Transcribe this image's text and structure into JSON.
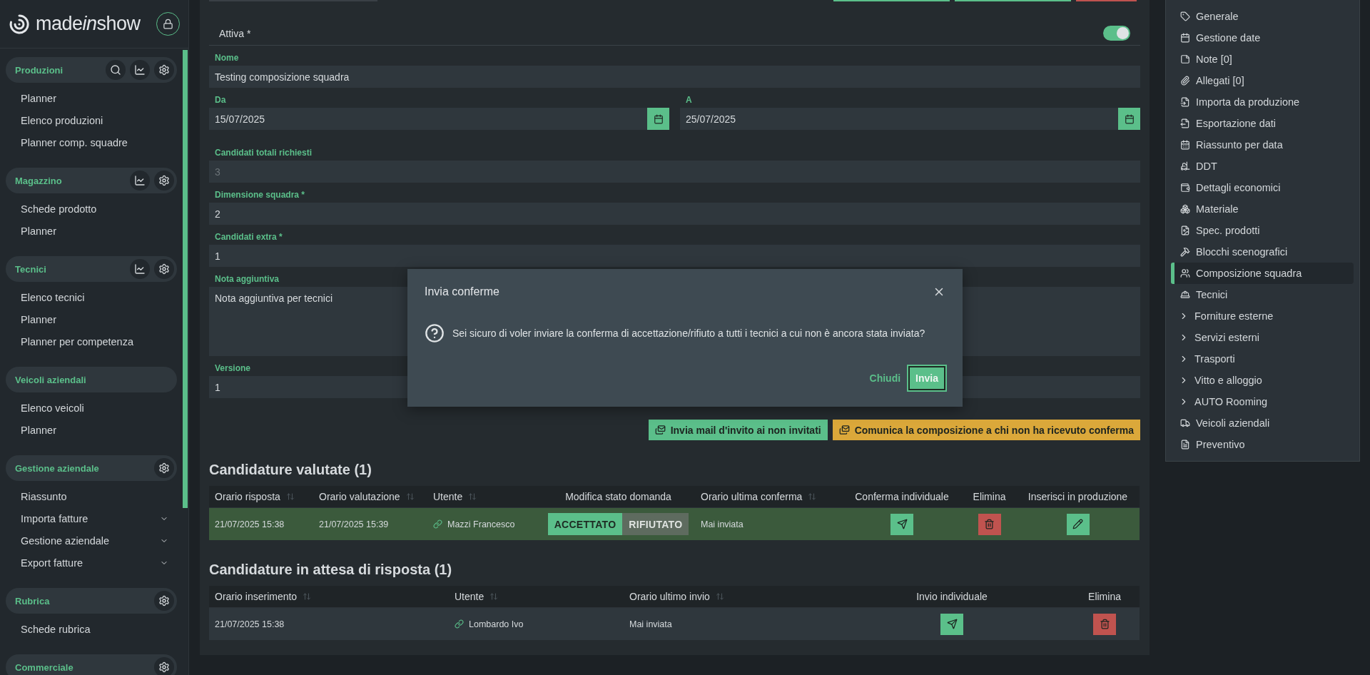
{
  "sidebar": {
    "logo": {
      "start": "made",
      "italic": "in",
      "end": "show"
    },
    "sections": [
      {
        "title": "Produzioni",
        "actions": [
          {
            "kind": "search"
          },
          {
            "kind": "stats"
          },
          {
            "kind": "settings"
          }
        ],
        "items": [
          {
            "label": "Planner"
          },
          {
            "label": "Elenco produzioni"
          },
          {
            "label": "Planner comp. squadre"
          }
        ]
      },
      {
        "title": "Magazzino",
        "actions": [
          {
            "kind": "stats"
          },
          {
            "kind": "settings"
          }
        ],
        "items": [
          {
            "label": "Schede prodotto"
          },
          {
            "label": "Planner"
          }
        ]
      },
      {
        "title": "Tecnici",
        "actions": [
          {
            "kind": "stats"
          },
          {
            "kind": "settings"
          }
        ],
        "items": [
          {
            "label": "Elenco tecnici"
          },
          {
            "label": "Planner"
          },
          {
            "label": "Planner per competenza"
          }
        ]
      },
      {
        "title": "Veicoli aziendali",
        "items": [
          {
            "label": "Elenco veicoli"
          },
          {
            "label": "Planner"
          }
        ]
      },
      {
        "title": "Gestione aziendale",
        "actions": [
          {
            "kind": "settings"
          }
        ],
        "items": [
          {
            "label": "Riassunto"
          },
          {
            "label": "Importa fatture",
            "expanded": false
          },
          {
            "label": "Gestione aziendale",
            "expanded": false
          },
          {
            "label": "Export fatture",
            "expanded": false
          }
        ]
      },
      {
        "title": "Rubrica",
        "actions": [
          {
            "kind": "settings"
          }
        ],
        "items": [
          {
            "label": "Schede rubrica"
          }
        ]
      },
      {
        "title": "Commerciale",
        "actions": [
          {
            "kind": "settings"
          }
        ]
      }
    ]
  },
  "top_edge": [
    {
      "kind": "field"
    },
    {
      "kind": "confirm"
    },
    {
      "kind": "confirm"
    },
    {
      "kind": "delete"
    }
  ],
  "form": {
    "active": {
      "label": "Attiva *",
      "on": true
    },
    "name": {
      "label": "Nome",
      "value": "Testing composizione squadra"
    },
    "dates": [
      {
        "label": "Da",
        "value": "15/07/2025"
      },
      {
        "label": "A",
        "value": "25/07/2025"
      }
    ],
    "fields": [
      {
        "label": "Candidati totali richiesti",
        "value": "3",
        "disabled": true
      },
      {
        "label": "Dimensione squadra *",
        "value": "2",
        "disabled": false
      },
      {
        "label": "Candidati extra *",
        "value": "1",
        "disabled": false
      }
    ],
    "note": {
      "label": "Nota aggiuntiva",
      "value": "Nota aggiuntiva per tecnici"
    },
    "version": {
      "label": "Versione",
      "value": "1"
    }
  },
  "actions": [
    {
      "label": "Invia mail d'invito ai non invitati",
      "kind": "primary"
    },
    {
      "label": "Comunica la composizione a chi non ha ricevuto conferma",
      "kind": "warning"
    }
  ],
  "tables": [
    {
      "title": "Candidature valutate (1)",
      "columns": [
        {
          "label": "Orario risposta",
          "sortable": true
        },
        {
          "label": "Orario valutazione",
          "sortable": true
        },
        {
          "label": "Utente",
          "sortable": true
        },
        {
          "label": "Modifica stato domanda",
          "sortable": false
        },
        {
          "label": "Orario ultima conferma",
          "sortable": true
        },
        {
          "label": "Conferma individuale",
          "sortable": false
        },
        {
          "label": "Elimina",
          "sortable": false
        },
        {
          "label": "Inserisci in produzione",
          "sortable": false
        }
      ],
      "rows": [
        {
          "highlighted": true,
          "cells": [
            {
              "kind": "text",
              "value": "21/07/2025 15:38"
            },
            {
              "kind": "text",
              "value": "21/07/2025 15:39"
            },
            {
              "kind": "user",
              "value": "Mazzi Francesco"
            },
            {
              "kind": "status",
              "options": [
                {
                  "label": "ACCETTATO",
                  "selected": true
                },
                {
                  "label": "RIFIUTATO",
                  "selected": false
                }
              ]
            },
            {
              "kind": "text",
              "value": "Mai inviata"
            },
            {
              "kind": "send"
            },
            {
              "kind": "delete"
            },
            {
              "kind": "edit"
            }
          ]
        }
      ]
    },
    {
      "title": "Candidature in attesa di risposta (1)",
      "columns": [
        {
          "label": "Orario inserimento",
          "sortable": true
        },
        {
          "label": "Utente",
          "sortable": true
        },
        {
          "label": "Orario ultimo invio",
          "sortable": true
        },
        {
          "label": "Invio individuale",
          "sortable": false
        },
        {
          "label": "Elimina",
          "sortable": false
        }
      ],
      "rows": [
        {
          "highlighted": false,
          "cells": [
            {
              "kind": "text",
              "value": "21/07/2025 15:38"
            },
            {
              "kind": "user",
              "value": "Lombardo Ivo"
            },
            {
              "kind": "text",
              "value": "Mai inviata"
            },
            {
              "kind": "send"
            },
            {
              "kind": "delete"
            }
          ]
        }
      ]
    }
  ],
  "side_menu": [
    {
      "label": "Generale",
      "kind": "link",
      "selected": false
    },
    {
      "label": "Gestione date",
      "kind": "link",
      "selected": false
    },
    {
      "label": "Note [0]",
      "kind": "link",
      "selected": false
    },
    {
      "label": "Allegati [0]",
      "kind": "link",
      "selected": false
    },
    {
      "label": "Importa da produzione",
      "kind": "link",
      "selected": false
    },
    {
      "label": "Esportazione dati",
      "kind": "link",
      "selected": false
    },
    {
      "label": "Riassunto per data",
      "kind": "link",
      "selected": false
    },
    {
      "label": "DDT",
      "kind": "link",
      "selected": false
    },
    {
      "label": "Dettagli economici",
      "kind": "link",
      "selected": false
    },
    {
      "label": "Materiale",
      "kind": "link",
      "selected": false
    },
    {
      "label": "Spec. prodotti",
      "kind": "link",
      "selected": false
    },
    {
      "label": "Blocchi scenografici",
      "kind": "link",
      "selected": false
    },
    {
      "label": "Composizione squadra",
      "kind": "link",
      "selected": true
    },
    {
      "label": "Tecnici",
      "kind": "link",
      "selected": false
    },
    {
      "label": "Forniture esterne",
      "kind": "group",
      "selected": false
    },
    {
      "label": "Servizi esterni",
      "kind": "group",
      "selected": false
    },
    {
      "label": "Trasporti",
      "kind": "group",
      "selected": false
    },
    {
      "label": "Vitto e alloggio",
      "kind": "group",
      "selected": false
    },
    {
      "label": "AUTO Rooming",
      "kind": "group",
      "selected": false
    },
    {
      "label": "Veicoli aziendali",
      "kind": "link",
      "selected": false
    },
    {
      "label": "Preventivo",
      "kind": "link",
      "selected": false
    }
  ],
  "dialog": {
    "title": "Invia conferme",
    "message": "Sei sicuro di voler inviare la conferma di accettazione/rifiuto a tutti i tecnici a cui non è ancora stata inviata?",
    "buttons": [
      {
        "label": "Chiudi",
        "kind": "text"
      },
      {
        "label": "Invia",
        "kind": "primary"
      }
    ]
  }
}
